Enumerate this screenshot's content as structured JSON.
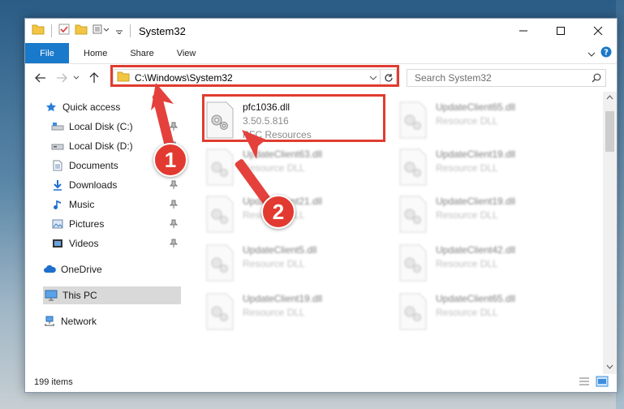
{
  "window": {
    "title": "System32"
  },
  "ribbon": {
    "tabs": [
      "File",
      "Home",
      "Share",
      "View"
    ]
  },
  "address": {
    "path": "C:\\Windows\\System32"
  },
  "search": {
    "placeholder": "Search System32"
  },
  "sidebar": {
    "items": [
      {
        "label": "Quick access",
        "icon": "star-icon",
        "pinned": false
      },
      {
        "label": "Local Disk (C:)",
        "icon": "drive-icon",
        "pinned": true
      },
      {
        "label": "Local Disk (D:)",
        "icon": "drive-icon",
        "pinned": true
      },
      {
        "label": "Documents",
        "icon": "documents-icon",
        "pinned": true
      },
      {
        "label": "Downloads",
        "icon": "download-icon",
        "pinned": true
      },
      {
        "label": "Music",
        "icon": "music-icon",
        "pinned": true
      },
      {
        "label": "Pictures",
        "icon": "pictures-icon",
        "pinned": true
      },
      {
        "label": "Videos",
        "icon": "videos-icon",
        "pinned": true
      },
      {
        "label": "OneDrive",
        "icon": "cloud-icon",
        "pinned": false
      },
      {
        "label": "This PC",
        "icon": "computer-icon",
        "pinned": false
      },
      {
        "label": "Network",
        "icon": "network-icon",
        "pinned": false
      }
    ]
  },
  "files": [
    {
      "name": "pfc1036.dll",
      "line1": "3.50.5.816",
      "line2": "PFC Resources"
    },
    {
      "name": "UpdateClient65.dll",
      "line1": "Resource DLL"
    },
    {
      "name": "UpdateClient63.dll",
      "line1": "Resource DLL"
    },
    {
      "name": "UpdateClient19.dll",
      "line1": "Resource DLL"
    },
    {
      "name": "UpdateClient21.dll",
      "line1": "Resource DLL"
    },
    {
      "name": "UpdateClient19.dll",
      "line1": "Resource DLL"
    },
    {
      "name": "UpdateClient5.dll",
      "line1": "Resource DLL"
    },
    {
      "name": "UpdateClient42.dll",
      "line1": "Resource DLL"
    },
    {
      "name": "UpdateClient19.dll",
      "line1": "Resource DLL"
    },
    {
      "name": "UpdateClient65.dll",
      "line1": "Resource DLL"
    }
  ],
  "status": {
    "item_count": "199 items"
  },
  "annotations": {
    "step1": "1",
    "step2": "2"
  },
  "colors": {
    "accent": "#1979ca",
    "annotation": "#e03c31"
  }
}
